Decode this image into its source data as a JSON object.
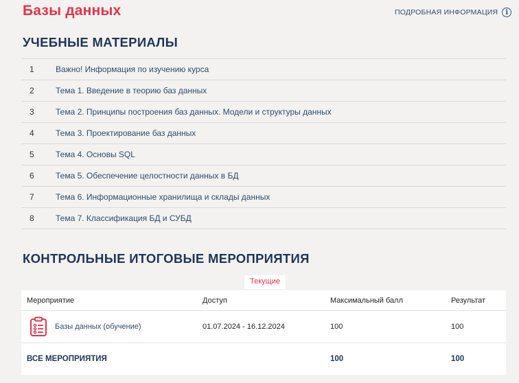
{
  "header": {
    "title": "Базы данных",
    "info_link": "ПОДРОБНАЯ ИНФОРМАЦИЯ",
    "info_icon": "info-icon"
  },
  "materials": {
    "section_title": "УЧЕБНЫЕ МАТЕРИАЛЫ",
    "items": [
      {
        "num": "1",
        "label": "Важно! Информация по изучению курса"
      },
      {
        "num": "2",
        "label": "Тема 1. Введение в теорию баз данных"
      },
      {
        "num": "3",
        "label": "Тема 2. Принципы построения баз данных. Модели и структуры данных"
      },
      {
        "num": "4",
        "label": "Тема 3. Проектирование баз данных"
      },
      {
        "num": "5",
        "label": "Тема 4. Основы SQL"
      },
      {
        "num": "6",
        "label": "Тема 5. Обеспечение целостности данных в БД"
      },
      {
        "num": "7",
        "label": "Тема 6. Информационные хранилища и склады данных"
      },
      {
        "num": "8",
        "label": "Тема 7. Классификация БД и СУБД"
      }
    ]
  },
  "events": {
    "section_title": "КОНТРОЛЬНЫЕ ИТОГОВЫЕ МЕРОПРИЯТИЯ",
    "current_tab": "Текущие",
    "columns": [
      "Мероприятие",
      "Доступ",
      "Максимальный балл",
      "Результат"
    ],
    "rows": [
      {
        "name": "Базы данных (обучение)",
        "access": "01.07.2024 - 16.12.2024",
        "max": "100",
        "result": "100",
        "icon": "checklist-icon"
      }
    ],
    "total": {
      "label": "ВСЕ МЕРОПРИЯТИЯ",
      "max": "100",
      "result": "100"
    }
  },
  "colors": {
    "accent": "#e0354d",
    "heading": "#1f3556",
    "link": "#2e4b6d"
  }
}
